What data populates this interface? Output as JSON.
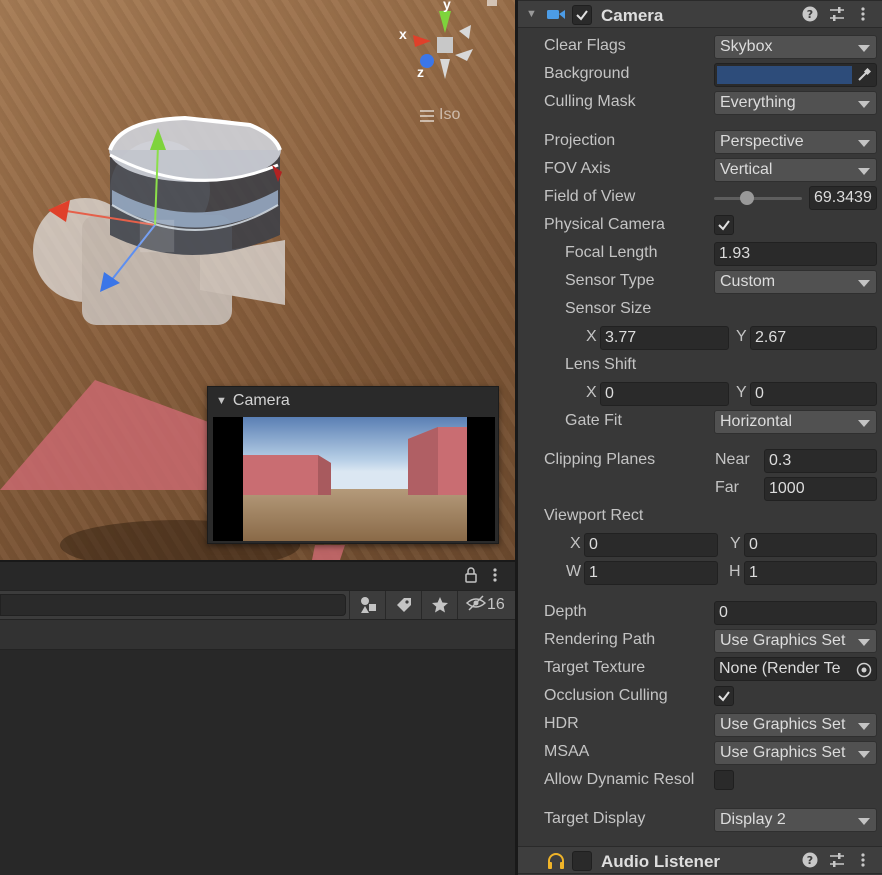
{
  "scene": {
    "iso_label": "Iso",
    "gizmo_axes": {
      "x": "x",
      "y": "y",
      "z": "z"
    },
    "preview": {
      "title": "Camera"
    }
  },
  "bottom": {
    "visible_count": "16"
  },
  "camera": {
    "title": "Camera",
    "enabled": true,
    "clear_flags": {
      "label": "Clear Flags",
      "value": "Skybox"
    },
    "background": {
      "label": "Background",
      "color": "#2d4c7a"
    },
    "culling_mask": {
      "label": "Culling Mask",
      "value": "Everything"
    },
    "projection": {
      "label": "Projection",
      "value": "Perspective"
    },
    "fov_axis": {
      "label": "FOV Axis",
      "value": "Vertical"
    },
    "field_of_view": {
      "label": "Field of View",
      "value": "69.3439",
      "slider_fraction": 0.37
    },
    "physical_camera": {
      "label": "Physical Camera",
      "checked": true
    },
    "focal_length": {
      "label": "Focal Length",
      "value": "1.93"
    },
    "sensor_type": {
      "label": "Sensor Type",
      "value": "Custom"
    },
    "sensor_size": {
      "label": "Sensor Size",
      "x_label": "X",
      "x": "3.77",
      "y_label": "Y",
      "y": "2.67"
    },
    "lens_shift": {
      "label": "Lens Shift",
      "x_label": "X",
      "x": "0",
      "y_label": "Y",
      "y": "0"
    },
    "gate_fit": {
      "label": "Gate Fit",
      "value": "Horizontal"
    },
    "clipping_planes": {
      "label": "Clipping Planes",
      "near_label": "Near",
      "near": "0.3",
      "far_label": "Far",
      "far": "1000"
    },
    "viewport_rect": {
      "label": "Viewport Rect",
      "x_label": "X",
      "x": "0",
      "y_label": "Y",
      "y": "0",
      "w_label": "W",
      "w": "1",
      "h_label": "H",
      "h": "1"
    },
    "depth": {
      "label": "Depth",
      "value": "0"
    },
    "rendering_path": {
      "label": "Rendering Path",
      "value": "Use Graphics Set"
    },
    "target_texture": {
      "label": "Target Texture",
      "value": "None (Render Te"
    },
    "occlusion_culling": {
      "label": "Occlusion Culling",
      "checked": true
    },
    "hdr": {
      "label": "HDR",
      "value": "Use Graphics Set"
    },
    "msaa": {
      "label": "MSAA",
      "value": "Use Graphics Set"
    },
    "allow_dynamic_resolution": {
      "label": "Allow Dynamic Resol",
      "checked": false
    },
    "target_display": {
      "label": "Target Display",
      "value": "Display 2"
    }
  },
  "audio_listener": {
    "title": "Audio Listener",
    "enabled": false
  },
  "colors": {
    "accent_blue": "#4c9ce6",
    "pink_plane": "#c9696f"
  }
}
